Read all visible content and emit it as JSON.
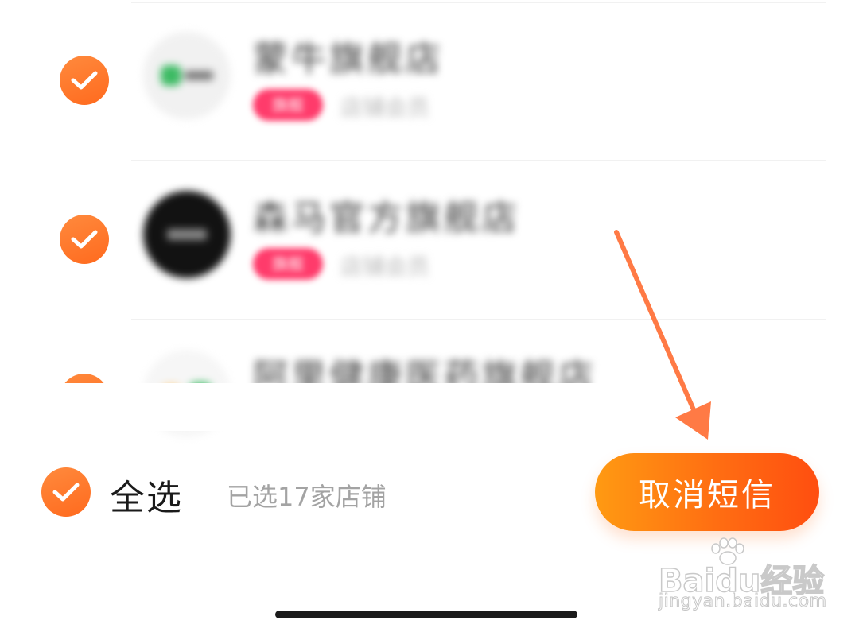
{
  "stores": [
    {
      "name": "蒙牛旗舰店",
      "tag": "旗舰",
      "sub": "店铺会员",
      "logo": "store-logo-1"
    },
    {
      "name": "森马官方旗舰店",
      "tag": "旗舰",
      "sub": "店铺会员",
      "logo": "store-logo-2"
    },
    {
      "name": "阿里健康医药旗舰店",
      "tag": "",
      "sub": "",
      "logo": "store-logo-3"
    }
  ],
  "footer": {
    "select_all_label": "全选",
    "selected_count_text": "已选17家店铺",
    "cancel_button_label": "取消短信"
  },
  "watermark": {
    "main": "Baidu经验",
    "sub": "jingyan.baidu.com"
  },
  "annotation": {
    "arrow_color": "#ff7a45"
  },
  "colors": {
    "accent": "#ff7a2e",
    "tag": "#ff3b6b",
    "button_start": "#ff9a12",
    "button_end": "#ff4e10"
  }
}
